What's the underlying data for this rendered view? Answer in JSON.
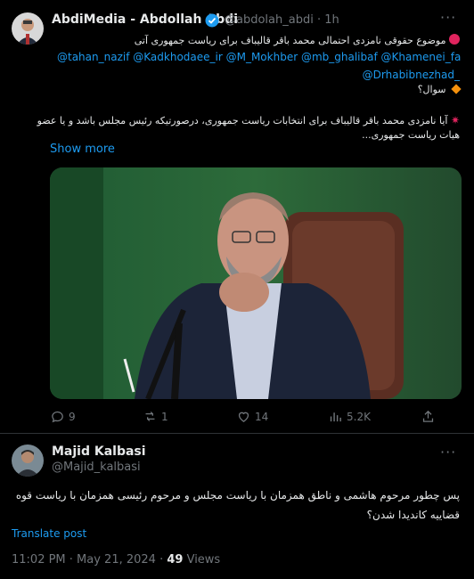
{
  "post": {
    "author_name": "AbdiMedia - Abdollah Abdi",
    "handle": "@abdolah_abdi",
    "separator": "·",
    "time": "1h",
    "line1": "موضوع حقوقی نامزدی احتمالی محمد باقر قالیباف برای ریاست جمهوری آتی",
    "mentions_line1": "@tahan_nazif @Kadkhodaee_ir @M_Mokhber @mb_ghalibaf @Khamenei_fa",
    "mentions_line2": "@Drhabibnezhad_",
    "question": "سوال؟",
    "body_line1": "آیا نامزدی محمد باقر قالیباف برای انتخابات ریاست جمهوری، درصورتیکه رئیس مجلس باشد و یا عضو",
    "body_line2": "هیات ریاست جمهوری...",
    "show_more": "Show more",
    "replies": "9",
    "reposts": "1",
    "likes": "14",
    "views": "5.2K"
  },
  "reply": {
    "author_name": "Majid Kalbasi",
    "handle": "@Majid_kalbasi",
    "text_line1": "پس چطور مرحوم هاشمی و ناطق همزمان با ریاست مجلس و مرحوم رئیسی همزمان با ریاست قوه",
    "text_line2": "قضاییه کاندیدا شدن؟",
    "translate": "Translate post",
    "timestamp": "11:02 PM · May 21, 2024 · ",
    "view_count": "49",
    "views_label": " Views"
  },
  "colors": {
    "accent": "#1d9bf0",
    "muted": "#71767b",
    "text": "#e7e9ea",
    "background": "#000000"
  },
  "icons": [
    "verified-badge-icon",
    "red-circle-emoji",
    "orange-diamond-emoji",
    "collision-emoji",
    "reply-icon",
    "repost-icon",
    "like-icon",
    "views-icon",
    "share-icon"
  ]
}
